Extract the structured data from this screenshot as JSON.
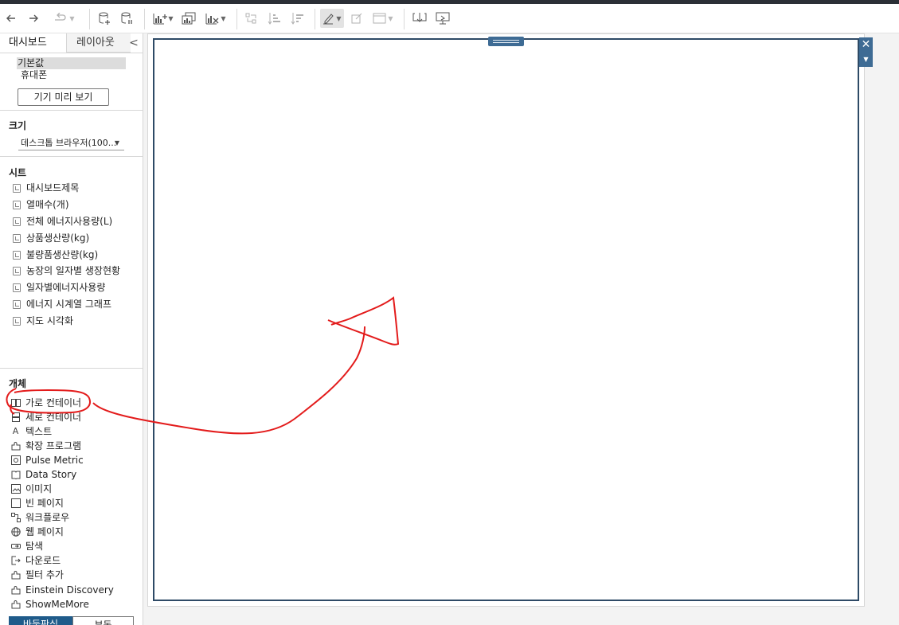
{
  "toolbar": {
    "buttons": [
      "back-icon",
      "forward-icon",
      "redo-icon",
      "new-datasource-icon",
      "pause-update-icon",
      "new-worksheet-icon",
      "duplicate-icon",
      "clear-sheet-icon",
      "swap-icon",
      "sort-asc-icon",
      "sort-desc-icon",
      "highlight-icon",
      "show-labels-icon",
      "fit-icon",
      "download-icon",
      "presentation-icon"
    ]
  },
  "sidebar": {
    "tabs": {
      "dashboard": "대시보드",
      "layout": "레이아웃",
      "collapse": "<"
    },
    "devices": [
      "기본값",
      "휴대폰"
    ],
    "device_preview_button": "기기 미리 보기",
    "size": {
      "title": "크기",
      "value": "데스크톱 브라우저(100..."
    },
    "sheets": {
      "title": "시트",
      "items": [
        "대시보드제목",
        "열매수(개)",
        "전체 에너지사용량(L)",
        "상품생산량(kg)",
        "불량품생산량(kg)",
        "농장의 일자별 생장현황",
        "일자별에너지사용량",
        "에너지 시계열 그래프",
        "지도 시각화"
      ]
    },
    "objects": {
      "title": "개체",
      "items": [
        {
          "label": "가로 컨테이너",
          "icon": "horizontal-container-icon"
        },
        {
          "label": "세로 컨테이너",
          "icon": "vertical-container-icon"
        },
        {
          "label": "텍스트",
          "icon": "text-icon"
        },
        {
          "label": "확장 프로그램",
          "icon": "extension-icon"
        },
        {
          "label": "Pulse Metric",
          "icon": "pulse-metric-icon"
        },
        {
          "label": "Data Story",
          "icon": "data-story-icon"
        },
        {
          "label": "이미지",
          "icon": "image-icon"
        },
        {
          "label": "빈 페이지",
          "icon": "blank-icon"
        },
        {
          "label": "워크플로우",
          "icon": "workflow-icon"
        },
        {
          "label": "웹 페이지",
          "icon": "web-page-icon"
        },
        {
          "label": "탐색",
          "icon": "navigation-icon"
        },
        {
          "label": "다운로드",
          "icon": "download-object-icon"
        },
        {
          "label": "필터 추가",
          "icon": "add-filter-icon"
        },
        {
          "label": "Einstein Discovery",
          "icon": "einstein-icon"
        },
        {
          "label": "ShowMeMore",
          "icon": "showmemore-icon"
        }
      ]
    },
    "bottom_tabs": [
      "바둑판식",
      "부동"
    ]
  },
  "canvas": {
    "close_label": "✕",
    "menu_label": "▼"
  },
  "colors": {
    "accent": "#3e6b94",
    "frame": "#2e4a66",
    "annotation": "#e31b1b",
    "tab_selected_bg": "#1f5b8a"
  }
}
